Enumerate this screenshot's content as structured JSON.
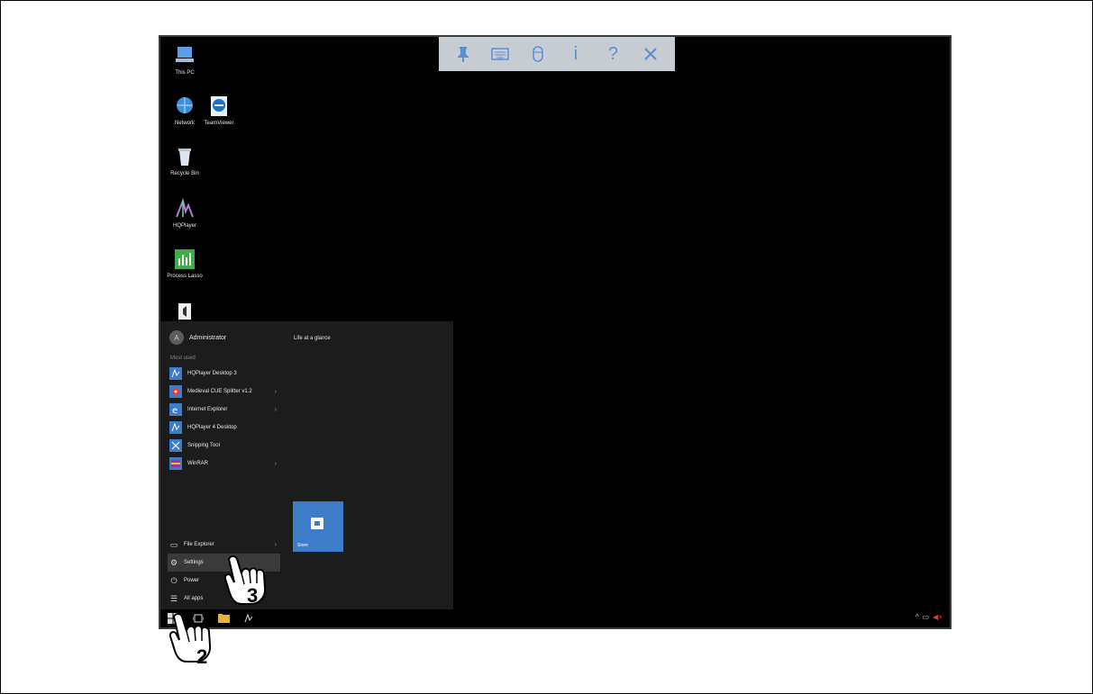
{
  "toolbar": {
    "buttons": [
      {
        "name": "pin",
        "glyph": "†"
      },
      {
        "name": "keyboard",
        "glyph": "⌨"
      },
      {
        "name": "mouse",
        "glyph": "▯"
      },
      {
        "name": "info",
        "glyph": "i"
      },
      {
        "name": "help",
        "glyph": "?"
      },
      {
        "name": "close",
        "glyph": "✕"
      }
    ]
  },
  "desktop": {
    "icons": [
      {
        "label": "This PC",
        "icon": "computer-icon"
      },
      {
        "label": "Network",
        "icon": "network-icon"
      },
      {
        "label": "TeamViewer",
        "icon": "teamviewer-icon"
      },
      {
        "label": "Recycle Bin",
        "icon": "recycle-bin-icon"
      },
      {
        "label": "HQPlayer",
        "icon": "hqplayer-icon"
      },
      {
        "label": "Process Lasso",
        "icon": "process-lasso-icon"
      }
    ]
  },
  "start_menu": {
    "user": "Administrator",
    "user_initial": "A",
    "most_used_label": "Most used",
    "apps": [
      {
        "label": "HQPlayer Desktop 3",
        "has_submenu": false
      },
      {
        "label": "Medieval CUE Splitter v1.2",
        "has_submenu": true
      },
      {
        "label": "Internet Explorer",
        "has_submenu": true
      },
      {
        "label": "HQPlayer 4 Desktop",
        "has_submenu": false
      },
      {
        "label": "Snipping Tool",
        "has_submenu": false
      },
      {
        "label": "WinRAR",
        "has_submenu": true
      }
    ],
    "bottom": {
      "file_explorer": "File Explorer",
      "settings": "Settings",
      "power": "Power",
      "all_apps": "All apps"
    },
    "right_title": "Life at a glance",
    "tile_label": "Store"
  },
  "callouts": {
    "step_start": "2",
    "step_settings": "3"
  },
  "colors": {
    "accent": "#3d7cc9",
    "toolbar_bg": "#c7ccd3",
    "toolbar_icon": "#5a8fd6",
    "menu_bg": "#1c1c1c"
  }
}
